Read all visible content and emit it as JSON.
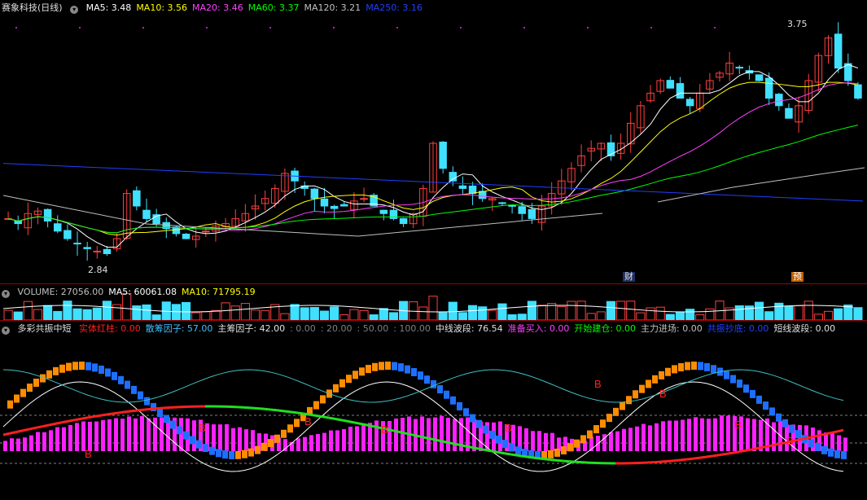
{
  "main_header": {
    "stock": "赛象科技(日线)",
    "items": [
      {
        "label": "MA5: 3.48",
        "color": "#ffffff"
      },
      {
        "label": "MA10: 3.56",
        "color": "#ffff00"
      },
      {
        "label": "MA20: 3.46",
        "color": "#ff40ff"
      },
      {
        "label": "MA60: 3.37",
        "color": "#00ff00"
      },
      {
        "label": "MA120: 3.21",
        "color": "#c0c0c0"
      },
      {
        "label": "MA250: 3.16",
        "color": "#2040ff"
      }
    ],
    "high_label": "3.75",
    "low_label": "2.84",
    "tag_cai": "财",
    "tag_yu": "预"
  },
  "vol_header": {
    "items": [
      {
        "label": "VOLUME: 27056.00",
        "color": "#c0c0c0"
      },
      {
        "label": "MA5: 60061.08",
        "color": "#ffffff"
      },
      {
        "label": "MA10: 71795.19",
        "color": "#ffff00"
      }
    ]
  },
  "ind_header": {
    "name": "多彩共振中短",
    "items": [
      {
        "label": "实体红柱: 0.00",
        "color": "#ff2020"
      },
      {
        "label": "散筹因子: 57.00",
        "color": "#40c0ff"
      },
      {
        "label": "主筹因子: 42.00",
        "color": "#e0e0e0"
      },
      {
        "label": ": 0.00",
        "color": "#808080"
      },
      {
        "label": ": 20.00",
        "color": "#808080"
      },
      {
        "label": ": 50.00",
        "color": "#808080"
      },
      {
        "label": ": 100.00",
        "color": "#808080"
      },
      {
        "label": "中线波段: 76.54",
        "color": "#e0e0e0"
      },
      {
        "label": "准备买入: 0.00",
        "color": "#ff40ff"
      },
      {
        "label": "开始建仓: 0.00",
        "color": "#00ff00"
      },
      {
        "label": "主力进场: 0.00",
        "color": "#c0c0c0"
      },
      {
        "label": "共振抄底: 0.00",
        "color": "#2040ff"
      },
      {
        "label": "短线波段: 0.00",
        "color": "#e0e0e0"
      }
    ],
    "buy_mark": "B"
  },
  "colors": {
    "up": "#ff4040",
    "down": "#40e0ff",
    "ma5": "#ffffff",
    "ma10": "#ffff00",
    "ma20": "#ff40ff",
    "ma60": "#00ff00",
    "ma120": "#c0c0c0",
    "ma250": "#2040ff",
    "grid": "#800000",
    "magenta": "#ff20ff",
    "orange": "#ff8c00",
    "blue": "#1e6fff"
  },
  "chart_data": {
    "type": "candlestick",
    "price_close_path": [
      3.0,
      2.98,
      3.02,
      3.03,
      2.99,
      2.95,
      2.92,
      2.9,
      2.88,
      2.87,
      2.86,
      2.92,
      3.1,
      3.05,
      3.0,
      2.98,
      2.96,
      2.94,
      2.92,
      2.93,
      2.95,
      2.97,
      2.98,
      3.0,
      3.02,
      3.05,
      3.08,
      3.12,
      3.18,
      3.15,
      3.12,
      3.08,
      3.05,
      3.04,
      3.05,
      3.07,
      3.08,
      3.05,
      3.02,
      3.0,
      2.98,
      3.02,
      3.12,
      3.3,
      3.2,
      3.15,
      3.12,
      3.1,
      3.08,
      3.08,
      3.06,
      3.05,
      3.02,
      3.0,
      3.05,
      3.1,
      3.15,
      3.2,
      3.25,
      3.28,
      3.3,
      3.25,
      3.3,
      3.38,
      3.45,
      3.5,
      3.55,
      3.52,
      3.48,
      3.45,
      3.5,
      3.55,
      3.58,
      3.62,
      3.6,
      3.58,
      3.55,
      3.48,
      3.45,
      3.4,
      3.45,
      3.55,
      3.65,
      3.72,
      3.6,
      3.55,
      3.48
    ],
    "annotations": {
      "high": 3.75,
      "low": 2.84
    },
    "volume": 27056.0,
    "volume_ma5": 60061.08,
    "volume_ma10": 71795.19,
    "indicator": {
      "散筹因子": 57.0,
      "主筹因子": 42.0,
      "中线波段": 76.54,
      "准备买入": 0.0,
      "开始建仓": 0.0,
      "主力进场": 0.0,
      "共振抄底": 0.0,
      "短线波段": 0.0,
      "实体红柱": 0.0,
      "levels": [
        0,
        20,
        50,
        100
      ]
    }
  }
}
